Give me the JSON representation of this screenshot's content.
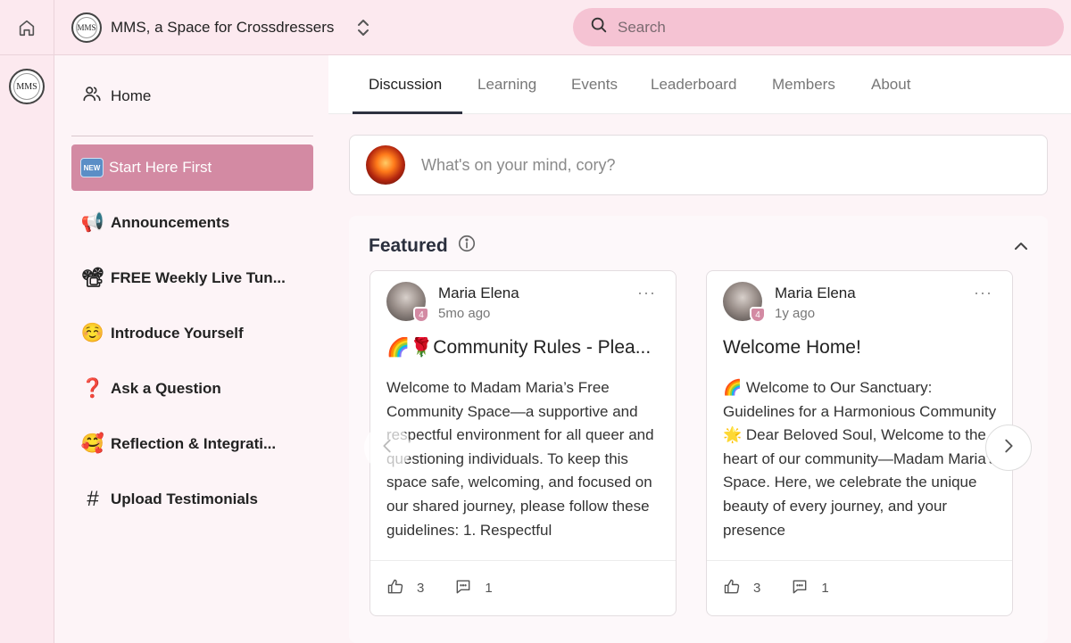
{
  "header": {
    "community_name": "MMS, a Space for Crossdressers",
    "logo_text": "MMS",
    "search_placeholder": "Search"
  },
  "rail": {
    "logo_text": "MMS"
  },
  "sidebar": {
    "home_label": "Home",
    "items": [
      {
        "label": "Start Here First",
        "icon": "new-badge",
        "emoji": "NEW"
      },
      {
        "label": "Announcements",
        "icon": "megaphone-icon",
        "emoji": "📢"
      },
      {
        "label": "FREE Weekly Live Tun...",
        "icon": "video-camera-icon",
        "emoji": "📽"
      },
      {
        "label": "Introduce Yourself",
        "icon": "smiling-face-icon",
        "emoji": "☺️"
      },
      {
        "label": "Ask a Question",
        "icon": "question-mark-icon",
        "emoji": "❓"
      },
      {
        "label": "Reflection & Integrati...",
        "icon": "smiling-hearts-face-icon",
        "emoji": "🥰"
      },
      {
        "label": "Upload Testimonials",
        "icon": "hashtag-lock-icon",
        "emoji": "#"
      }
    ]
  },
  "tabs": [
    "Discussion",
    "Learning",
    "Events",
    "Leaderboard",
    "Members",
    "About"
  ],
  "composer": {
    "placeholder": "What's on your mind, cory?"
  },
  "featured": {
    "title": "Featured",
    "posts": [
      {
        "author": "Maria Elena",
        "level": "4",
        "time": "5mo ago",
        "title": "🌈🌹Community Rules - Plea...",
        "body": "Welcome to Madam Maria’s Free Community Space—a supportive and respectful environment for all queer and questioning individuals. To keep this space safe, welcoming, and focused on our shared journey, please follow these guidelines: 1. Respectful",
        "likes": "3",
        "comments": "1"
      },
      {
        "author": "Maria Elena",
        "level": "4",
        "time": "1y ago",
        "title": "Welcome Home!",
        "body": "🌈 Welcome to Our Sanctuary: Guidelines for a Harmonious Community 🌟 Dear Beloved Soul, Welcome to the heart of our community—Madam Maria's Space. Here, we celebrate the unique beauty of every journey, and your presence",
        "likes": "3",
        "comments": "1"
      }
    ]
  },
  "colors": {
    "accent_pink": "#d38aa3",
    "search_bg": "#f5c3d3",
    "header_bg": "#fce9ef"
  }
}
